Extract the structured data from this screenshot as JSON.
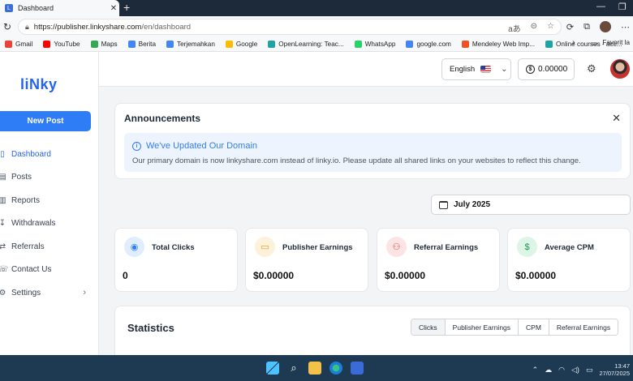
{
  "browser": {
    "tab_title": "Dashboard",
    "url_host": "https://publisher.linkyshare.com",
    "url_path": "/en/dashboard",
    "bookmarks": [
      {
        "label": "Gmail",
        "color": "#ea4335"
      },
      {
        "label": "YouTube",
        "color": "#ff0000"
      },
      {
        "label": "Maps",
        "color": "#34a853"
      },
      {
        "label": "Berita",
        "color": "#4285f4"
      },
      {
        "label": "Terjemahkan",
        "color": "#4285f4"
      },
      {
        "label": "Google",
        "color": "#fbbc05"
      },
      {
        "label": "OpenLearning: Teac...",
        "color": "#1fa3a3"
      },
      {
        "label": "WhatsApp",
        "color": "#25d366"
      },
      {
        "label": "google.com",
        "color": "#4285f4"
      },
      {
        "label": "Mendeley Web Imp...",
        "color": "#f25022"
      },
      {
        "label": "Online courses - acc...",
        "color": "#1fa3a3"
      }
    ],
    "bookmarks_overflow": "Favorit la"
  },
  "sidebar": {
    "logo": "liNky",
    "new_post": "New Post",
    "items": [
      {
        "label": "Dashboard",
        "icon": "dashboard-icon",
        "glyph": "▯",
        "active": true
      },
      {
        "label": "Posts",
        "icon": "posts-icon",
        "glyph": "▤",
        "active": false
      },
      {
        "label": "Reports",
        "icon": "reports-icon",
        "glyph": "▥",
        "active": false
      },
      {
        "label": "Withdrawals",
        "icon": "withdrawals-icon",
        "glyph": "↧",
        "active": false
      },
      {
        "label": "Referrals",
        "icon": "referrals-icon",
        "glyph": "⇄",
        "active": false
      },
      {
        "label": "Contact Us",
        "icon": "contact-icon",
        "glyph": "☏",
        "active": false
      },
      {
        "label": "Settings",
        "icon": "settings-icon",
        "glyph": "⚙",
        "active": false
      }
    ]
  },
  "header": {
    "language": "English",
    "balance": "0.00000"
  },
  "announcements": {
    "title": "Announcements",
    "alert_title": "We've Updated Our Domain",
    "alert_text": "Our primary domain is now linkyshare.com instead of linky.io. Please update all shared links on your websites to reflect this change."
  },
  "date_filter": "July 2025",
  "cards": [
    {
      "label": "Total Clicks",
      "value": "0",
      "icon": "eye-icon",
      "glyph": "◉",
      "bg": "#e0edfd",
      "fg": "#2f7df6"
    },
    {
      "label": "Publisher Earnings",
      "value": "$0.00000",
      "icon": "wallet-icon",
      "glyph": "▭",
      "bg": "#fdf1dc",
      "fg": "#e0a020"
    },
    {
      "label": "Referral Earnings",
      "value": "$0.00000",
      "icon": "user-plus-icon",
      "glyph": "⚇",
      "bg": "#fde4e4",
      "fg": "#e04b4b"
    },
    {
      "label": "Average CPM",
      "value": "$0.00000",
      "icon": "dollar-icon",
      "glyph": "$",
      "bg": "#dcf5e6",
      "fg": "#1f9a55"
    }
  ],
  "statistics": {
    "title": "Statistics",
    "tabs": [
      "Clicks",
      "Publisher Earnings",
      "CPM",
      "Referral Earnings"
    ],
    "active_tab": 0
  },
  "taskbar": {
    "time": "13:47",
    "date": "27/07/2025"
  }
}
